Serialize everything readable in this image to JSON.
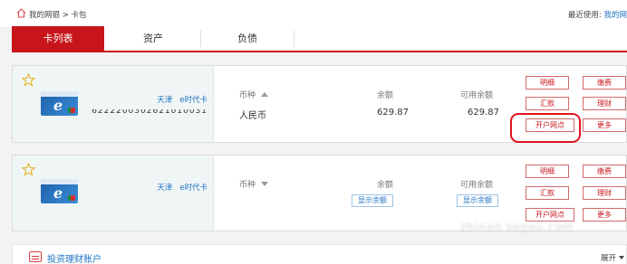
{
  "breadcrumb": {
    "text": "我的网银 > 卡包",
    "home_icon": "home-icon"
  },
  "recent": {
    "label": "最近使用:",
    "link": "我的网"
  },
  "tabs": [
    {
      "label": "卡列表",
      "active": true
    },
    {
      "label": "资产",
      "active": false
    },
    {
      "label": "负债",
      "active": false
    }
  ],
  "colors": {
    "brand_red": "#c7151b",
    "link_blue": "#1f73c4",
    "card_bg": "#f0f6f6"
  },
  "cards": [
    {
      "title_region": "天津",
      "title_type": "e时代卡",
      "number": "6222200302621010031",
      "currency_header": "币种",
      "balance_header": "余额",
      "available_header": "可用余额",
      "currency": "人民币",
      "balance": "629.87",
      "available": "629.87",
      "actions": [
        "明细",
        "缴费",
        "汇款",
        "理财",
        "开户网点",
        "更多"
      ]
    },
    {
      "title_region": "天津",
      "title_type": "e时代卡",
      "currency_header": "币种",
      "balance_header": "余额",
      "available_header": "可用余额",
      "show_balance": "显示余额",
      "show_available": "显示余额",
      "actions": [
        "明细",
        "缴费",
        "汇款",
        "理财",
        "开户网点",
        "更多"
      ]
    }
  ],
  "investment": {
    "title": "投资理财账户",
    "expand": "展开"
  },
  "watermark": "zhinan.sogou.com"
}
